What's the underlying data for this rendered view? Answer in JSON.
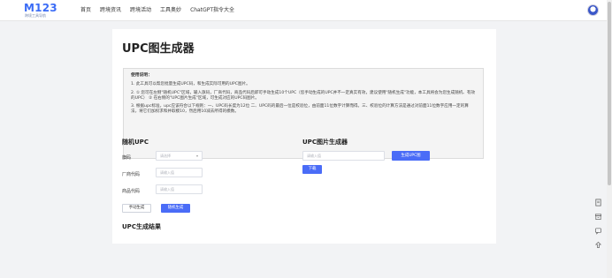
{
  "brand": {
    "logo_text": "M123",
    "logo_sub": "跨境工具导航"
  },
  "nav": [
    {
      "label": "首页"
    },
    {
      "label": "跨境资讯"
    },
    {
      "label": "跨境活动"
    },
    {
      "label": "工具奥妙"
    },
    {
      "label": "ChatGPT指令大全"
    }
  ],
  "page": {
    "title": "UPC图生成器"
  },
  "notes": {
    "title": "使用说明：",
    "items": [
      "1. 此工具可以帮您批量生成UPC码，和生成实际可用的UPC图片。",
      "2. ① 您可在左侧\"随机UPC\"区域，输入旗码，厂商代码，商品代码后即可手动生成10个UPC（您手动生成的UPC并不一定真实有效，建议使用\"随机生成\"功能，本工具将会为您生成随机、有效的UPC） ② 在右侧的\"UPC图片生成\"区域，可生成对应的UPC码图片。",
      "3. 根据upc标准，upc应该符合以下规则：一、UPC码长度为12位 二、UPC码的最后一位是校验位，由前面11位数字计算而得。三、校验位的计算方法是通过对前面11位数字应用一定的算法，将它们加权求和并取模10，然后用10减去所得的模数。"
    ]
  },
  "random_upc": {
    "title": "随机UPC",
    "flag_label": "旗码",
    "flag_placeholder": "请选择",
    "maker_label": "厂商代码",
    "maker_placeholder": "请输入值",
    "product_label": "商品代码",
    "product_placeholder": "请输入值",
    "manual_button": "手动生成",
    "random_button": "随机生成"
  },
  "image_gen": {
    "title": "UPC图片生成器",
    "input_placeholder": "请输入值",
    "generate_button": "生成UPC图",
    "download_button": "下载"
  },
  "result": {
    "title": "UPC生成结果"
  },
  "colors": {
    "primary": "#4a6cf7",
    "brand": "#3b6cf6",
    "page_bg": "#f2f3f5"
  },
  "float_tools": [
    "document-icon",
    "archive-icon",
    "chat-icon",
    "arrow-up-icon"
  ]
}
